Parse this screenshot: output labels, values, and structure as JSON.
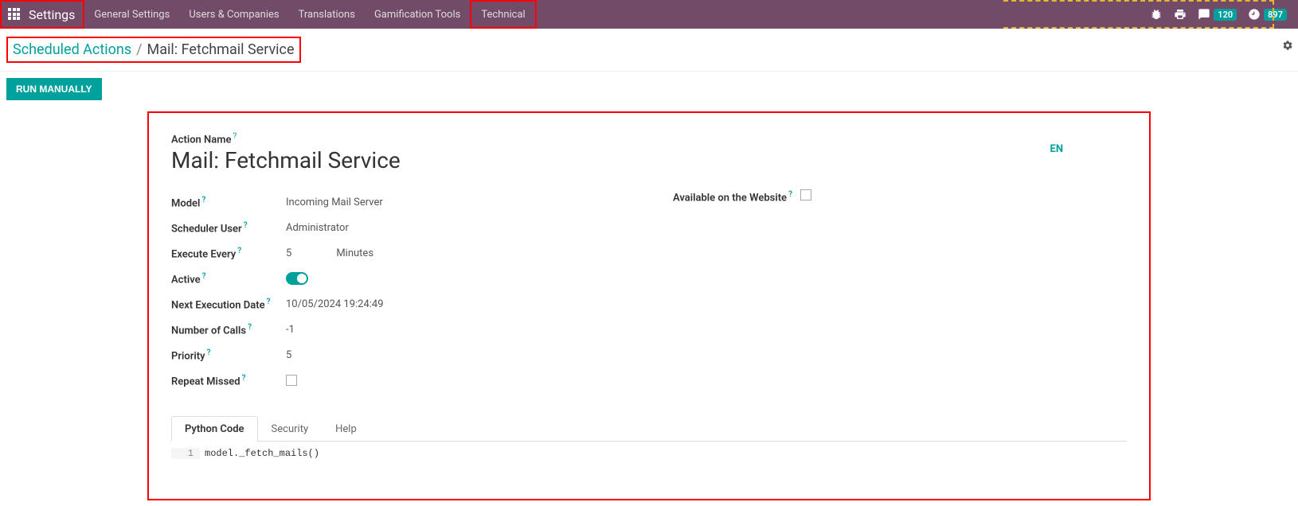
{
  "nav": {
    "brand": "Settings",
    "items": [
      "General Settings",
      "Users & Companies",
      "Translations",
      "Gamification Tools",
      "Technical"
    ],
    "messages_badge": "120",
    "activities_badge": "897"
  },
  "breadcrumb": {
    "parent": "Scheduled Actions",
    "sep": "/",
    "current": "Mail: Fetchmail Service"
  },
  "actions": {
    "run_manually": "RUN MANUALLY"
  },
  "form": {
    "action_name_label": "Action Name",
    "title": "Mail: Fetchmail Service",
    "lang": "EN",
    "fields": {
      "model_label": "Model",
      "model_value": "Incoming Mail Server",
      "scheduler_user_label": "Scheduler User",
      "scheduler_user_value": "Administrator",
      "execute_every_label": "Execute Every",
      "execute_every_value": "5",
      "execute_every_unit": "Minutes",
      "active_label": "Active",
      "active_value": true,
      "next_exec_label": "Next Execution Date",
      "next_exec_value": "10/05/2024 19:24:49",
      "calls_label": "Number of Calls",
      "calls_value": "-1",
      "priority_label": "Priority",
      "priority_value": "5",
      "repeat_missed_label": "Repeat Missed",
      "repeat_missed_value": false,
      "available_website_label": "Available on the Website",
      "available_website_value": false
    },
    "tabs": [
      "Python Code",
      "Security",
      "Help"
    ],
    "code": {
      "line_no": "1",
      "content": "model._fetch_mails()"
    }
  }
}
